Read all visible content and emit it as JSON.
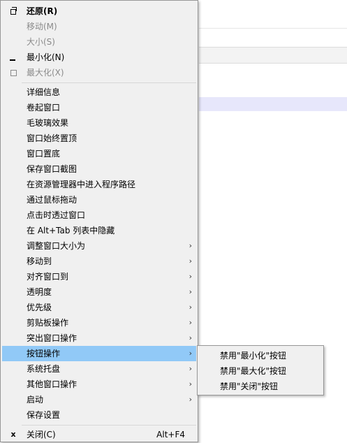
{
  "context_menu": {
    "items": [
      {
        "label": "还原(R)"
      },
      {
        "label": "移动(M)"
      },
      {
        "label": "大小(S)"
      },
      {
        "label": "最小化(N)"
      },
      {
        "label": "最大化(X)"
      },
      {
        "label": "详细信息"
      },
      {
        "label": "卷起窗口"
      },
      {
        "label": "毛玻璃效果"
      },
      {
        "label": "窗口始终置顶"
      },
      {
        "label": "窗口置底"
      },
      {
        "label": "保存窗口截图"
      },
      {
        "label": "在资源管理器中进入程序路径"
      },
      {
        "label": "通过鼠标拖动"
      },
      {
        "label": "点击时透过窗口"
      },
      {
        "label": "在 Alt+Tab 列表中隐藏"
      },
      {
        "label": "调整窗口大小为"
      },
      {
        "label": "移动到"
      },
      {
        "label": "对齐窗口到"
      },
      {
        "label": "透明度"
      },
      {
        "label": "优先级"
      },
      {
        "label": "剪贴板操作"
      },
      {
        "label": "突出窗口操作"
      },
      {
        "label": "按钮操作"
      },
      {
        "label": "系统托盘"
      },
      {
        "label": "其他窗口操作"
      },
      {
        "label": "启动"
      },
      {
        "label": "保存设置"
      },
      {
        "label": "关闭(C)",
        "shortcut": "Alt+F4"
      }
    ],
    "arrow_glyph": "›",
    "close_glyph": "x"
  },
  "submenu": {
    "items": [
      {
        "label": "禁用\"最小化\"按钮"
      },
      {
        "label": "禁用\"最大化\"按钮"
      },
      {
        "label": "禁用\"关闭\"按钮"
      }
    ]
  },
  "colors": {
    "menu_bg": "#f0f0f0",
    "highlight": "#91c9f7",
    "disabled_text": "#8a8a8a"
  }
}
